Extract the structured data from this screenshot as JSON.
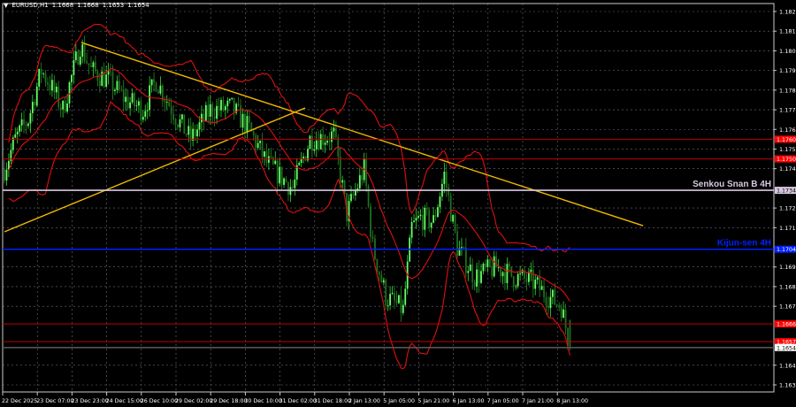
{
  "header": {
    "symbol": "EURUSD,H1",
    "open": "1.1668",
    "high": "1.1668",
    "low": "1.1653",
    "close": "1.1654"
  },
  "colors": {
    "background": "#000000",
    "bull_candle": "#33dd33",
    "bear_candle": "#2a8a2a",
    "bands": "#e01010",
    "trendline": "#f0b800",
    "senkou": "#d8c8e0",
    "kijun": "#0020ff",
    "level": "#c00000",
    "grid": "#6a7080"
  },
  "chart_data": {
    "type": "candlestick",
    "title": "EURUSD,H1",
    "ylim": [
      1.1628,
      1.1831
    ],
    "y_ticks": [
      "1.1825",
      "1.1815",
      "1.1805",
      "1.1795",
      "1.1785",
      "1.1775",
      "1.1765",
      "1.1755",
      "1.1745",
      "1.1725",
      "1.1715",
      "1.1695",
      "1.1685",
      "1.1675",
      "1.1645",
      "1.1635"
    ],
    "x_ticks": [
      "22 Dec 2025",
      "23 Dec 07:00",
      "23 Dec 23:00",
      "24 Dec 15:00",
      "26 Dec 10:00",
      "29 Dec 02:00",
      "29 Dec 18:00",
      "30 Dec 10:00",
      "31 Dec 02:00",
      "31 Dec 18:00",
      "2 Jan 13:00",
      "5 Jan 05:00",
      "5 Jan 21:00",
      "6 Jan 13:00",
      "7 Jan 05:00",
      "7 Jan 21:00",
      "8 Jan 13:00"
    ],
    "bars_between_ticks": 16,
    "total_bars": 262,
    "close_path": [
      [
        0,
        1.1745
      ],
      [
        5,
        1.176
      ],
      [
        11,
        1.177
      ],
      [
        17,
        1.1795
      ],
      [
        21,
        1.1788
      ],
      [
        27,
        1.1775
      ],
      [
        35,
        1.1808
      ],
      [
        40,
        1.1795
      ],
      [
        48,
        1.179
      ],
      [
        56,
        1.178
      ],
      [
        64,
        1.1775
      ],
      [
        70,
        1.179
      ],
      [
        80,
        1.177
      ],
      [
        86,
        1.176
      ],
      [
        95,
        1.1775
      ],
      [
        105,
        1.1776
      ],
      [
        113,
        1.1765
      ],
      [
        121,
        1.1748
      ],
      [
        133,
        1.1735
      ],
      [
        141,
        1.176
      ],
      [
        152,
        1.1762
      ],
      [
        158,
        1.1722
      ],
      [
        166,
        1.1745
      ],
      [
        170,
        1.1705
      ],
      [
        176,
        1.168
      ],
      [
        184,
        1.1673
      ],
      [
        188,
        1.1715
      ],
      [
        192,
        1.172
      ],
      [
        198,
        1.1718
      ],
      [
        203,
        1.1742
      ],
      [
        209,
        1.1705
      ],
      [
        217,
        1.169
      ],
      [
        227,
        1.1695
      ],
      [
        235,
        1.169
      ],
      [
        243,
        1.1688
      ],
      [
        251,
        1.168
      ],
      [
        257,
        1.1675
      ],
      [
        261,
        1.1654
      ]
    ],
    "indicators": {
      "bollinger": {
        "period": 20,
        "deviations": 2
      }
    },
    "trendlines": [
      {
        "name": "descending-resistance",
        "from": [
          35.5,
          1.18092
        ],
        "to": [
          294.7,
          1.1716
        ]
      },
      {
        "name": "ascending-support",
        "from": [
          0,
          1.17129
        ],
        "to": [
          138.8,
          1.17759
        ]
      }
    ],
    "levels": [
      {
        "price": 1.176,
        "label": "1.1760",
        "kind": "level"
      },
      {
        "price": 1.175,
        "label": "1.1750",
        "kind": "level"
      },
      {
        "price": 1.1734,
        "label": "1.1734",
        "kind": "senkou",
        "text": "Senkou Snan B 4H"
      },
      {
        "price": 1.1704,
        "label": "1.1704",
        "kind": "kijun",
        "text": "Kijun-sen 4H"
      },
      {
        "price": 1.1666,
        "label": "1.1666",
        "kind": "level"
      },
      {
        "price": 1.1657,
        "label": "1.1657",
        "kind": "level"
      },
      {
        "price": 1.1654,
        "label": "1.1654",
        "kind": "current"
      }
    ]
  }
}
